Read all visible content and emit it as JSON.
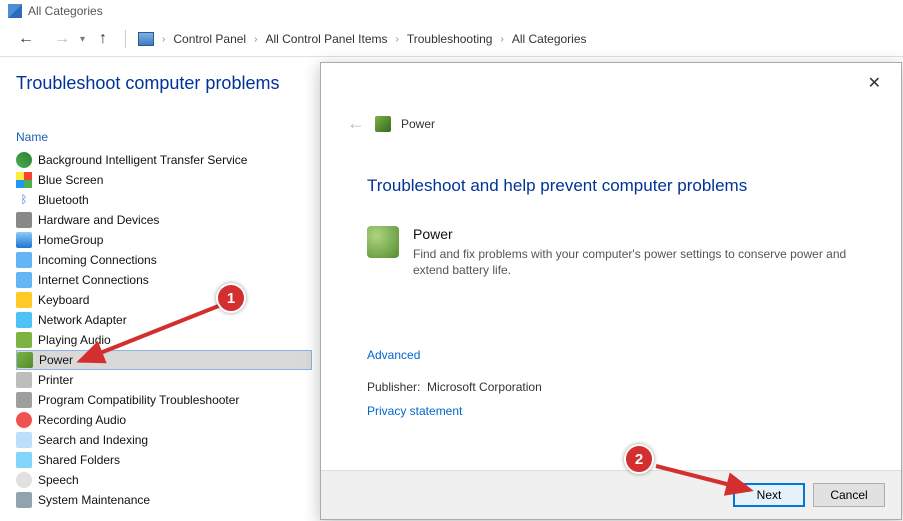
{
  "window": {
    "title": "All Categories"
  },
  "breadcrumb": {
    "items": [
      "Control Panel",
      "All Control Panel Items",
      "Troubleshooting",
      "All Categories"
    ]
  },
  "page": {
    "heading": "Troubleshoot computer problems",
    "column_header": "Name"
  },
  "items": {
    "list": [
      {
        "label": "Background Intelligent Transfer Service",
        "icon": "bits-icon"
      },
      {
        "label": "Blue Screen",
        "icon": "bluescreen-icon"
      },
      {
        "label": "Bluetooth",
        "icon": "bluetooth-icon"
      },
      {
        "label": "Hardware and Devices",
        "icon": "hardware-icon"
      },
      {
        "label": "HomeGroup",
        "icon": "homegroup-icon"
      },
      {
        "label": "Incoming Connections",
        "icon": "network-icon"
      },
      {
        "label": "Internet Connections",
        "icon": "network-icon"
      },
      {
        "label": "Keyboard",
        "icon": "keyboard-icon"
      },
      {
        "label": "Network Adapter",
        "icon": "network-adapter-icon"
      },
      {
        "label": "Playing Audio",
        "icon": "audio-icon"
      },
      {
        "label": "Power",
        "icon": "power-icon",
        "selected": true
      },
      {
        "label": "Printer",
        "icon": "printer-icon"
      },
      {
        "label": "Program Compatibility Troubleshooter",
        "icon": "compat-icon"
      },
      {
        "label": "Recording Audio",
        "icon": "recording-icon"
      },
      {
        "label": "Search and Indexing",
        "icon": "search-icon"
      },
      {
        "label": "Shared Folders",
        "icon": "folders-icon"
      },
      {
        "label": "Speech",
        "icon": "speech-icon"
      },
      {
        "label": "System Maintenance",
        "icon": "system-icon"
      }
    ]
  },
  "dialog": {
    "header_title": "Power",
    "heading": "Troubleshoot and help prevent computer problems",
    "section_title": "Power",
    "section_desc": "Find and fix problems with your computer's power settings to conserve power and extend battery life.",
    "advanced_link": "Advanced",
    "publisher_label": "Publisher:",
    "publisher_value": "Microsoft Corporation",
    "privacy_link": "Privacy statement",
    "next_button": "Next",
    "cancel_button": "Cancel"
  },
  "annotations": {
    "marker1": "1",
    "marker2": "2"
  }
}
